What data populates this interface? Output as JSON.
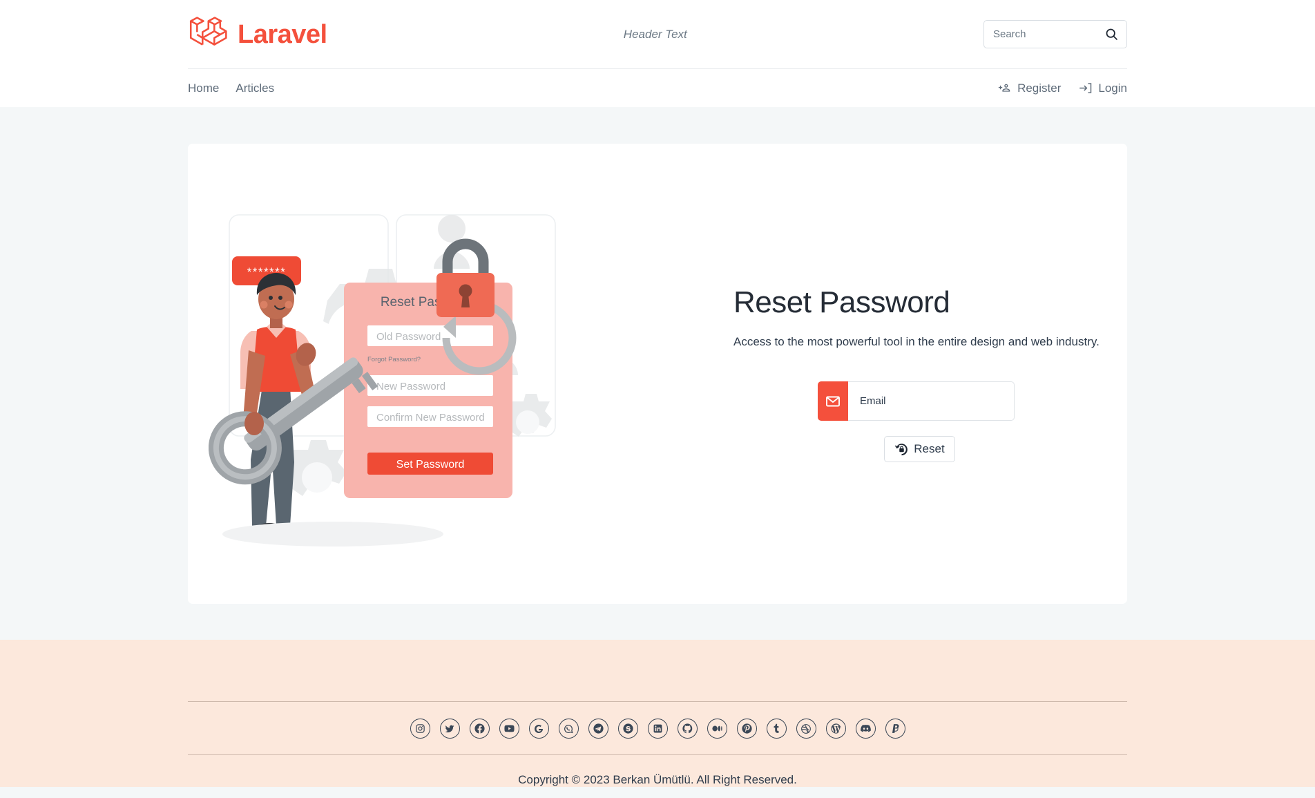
{
  "header": {
    "brand_name": "Laravel",
    "brand_logo_icon": "laravel-logo-icon",
    "center_text": "Header Text",
    "search": {
      "value": "",
      "placeholder": "Search",
      "icon": "search-icon"
    },
    "nav_left": [
      {
        "label": "Home",
        "name": "home"
      },
      {
        "label": "Articles",
        "name": "articles"
      }
    ],
    "nav_right": [
      {
        "label": "Register",
        "name": "register",
        "icon": "person-add-icon"
      },
      {
        "label": "Login",
        "name": "login",
        "icon": "login-arrow-icon"
      }
    ]
  },
  "main": {
    "title": "Reset Password",
    "subtitle": "Access to the most powerful tool in the entire design and web industry.",
    "email": {
      "placeholder": "Email",
      "value": "",
      "prefix_icon": "envelope-icon"
    },
    "reset_button": {
      "label": "Reset",
      "icon": "lock-reset-icon"
    },
    "illustration": {
      "name": "reset-password-illustration",
      "bubble_text": "*******",
      "form_title": "Reset Password",
      "field_old_password": "Old Password",
      "forgot_link": "Forgot Password?",
      "field_new_password": "New Password",
      "field_confirm_password": "Confirm New Password",
      "submit_label": "Set Password"
    }
  },
  "footer": {
    "social": [
      {
        "name": "instagram",
        "label": "Instagram"
      },
      {
        "name": "twitter",
        "label": "Twitter"
      },
      {
        "name": "facebook",
        "label": "Facebook"
      },
      {
        "name": "youtube",
        "label": "YouTube"
      },
      {
        "name": "google",
        "label": "Google"
      },
      {
        "name": "whatsapp",
        "label": "WhatsApp"
      },
      {
        "name": "telegram",
        "label": "Telegram"
      },
      {
        "name": "skype",
        "label": "Skype"
      },
      {
        "name": "linkedin",
        "label": "LinkedIn"
      },
      {
        "name": "github",
        "label": "GitHub"
      },
      {
        "name": "medium",
        "label": "Medium"
      },
      {
        "name": "pinterest",
        "label": "Pinterest"
      },
      {
        "name": "tumblr",
        "label": "Tumblr"
      },
      {
        "name": "dribbble",
        "label": "Dribbble"
      },
      {
        "name": "wordpress",
        "label": "WordPress"
      },
      {
        "name": "discord",
        "label": "Discord"
      },
      {
        "name": "paypal",
        "label": "PayPal"
      }
    ],
    "copyright": "Copyright © 2023 Berkan Ümütlü. All Right Reserved."
  },
  "colors": {
    "brand_red": "#f4503c",
    "page_bg": "#f4f7f8",
    "footer_bg": "#fce8dc",
    "card_bg": "#ffffff",
    "text": "#2f3c4c",
    "muted": "#6b7884"
  }
}
